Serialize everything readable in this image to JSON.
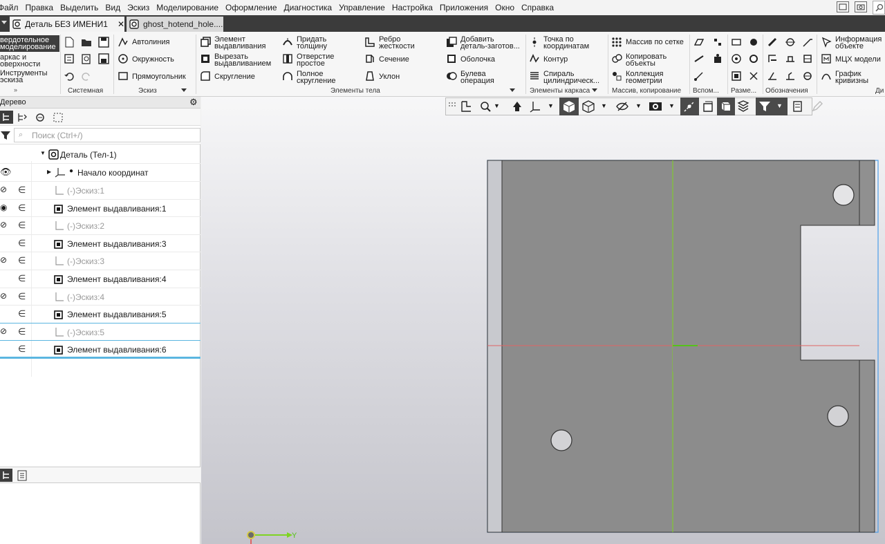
{
  "menu": [
    "Файл",
    "Правка",
    "Выделить",
    "Вид",
    "Эскиз",
    "Моделирование",
    "Оформление",
    "Диагностика",
    "Управление",
    "Настройка",
    "Приложения",
    "Окно",
    "Справка"
  ],
  "tabs": [
    {
      "label": "Деталь БЕЗ ИМЕНИ1",
      "close": "✕"
    },
    {
      "label": "ghost_hotend_hole...."
    }
  ],
  "ribbon": {
    "categories": [
      {
        "line1": "вердотельное",
        "line2": "моделирование"
      },
      {
        "line1": "аркас и",
        "line2": "оверхности"
      },
      {
        "line1": "Инструменты",
        "line2": "эскиза"
      }
    ],
    "sketch_tools": [
      "Автолиния",
      "Окружность",
      "Прямоугольник"
    ],
    "body_tools": {
      "extrude": [
        "Элемент",
        "выдавливания"
      ],
      "cut_extrude": [
        "Вырезать",
        "выдавливанием"
      ],
      "fillet": "Скругление",
      "thicken": [
        "Придать",
        "толщину"
      ],
      "hole": [
        "Отверстие",
        "простое"
      ],
      "full_fillet": [
        "Полное",
        "скругление"
      ],
      "rib": [
        "Ребро",
        "жесткости"
      ],
      "section": "Сечение",
      "draft": "Уклон",
      "add_body": [
        "Добавить",
        "деталь-заготов..."
      ],
      "shell": "Оболочка",
      "boolean": [
        "Булева",
        "операция"
      ]
    },
    "frame_tools": {
      "point": [
        "Точка по",
        "координатам"
      ],
      "contour": "Контур",
      "spiral": [
        "Спираль",
        "цилиндрическ..."
      ]
    },
    "array_tools": {
      "grid_array": "Массив по сетке",
      "copy": [
        "Копировать",
        "объекты"
      ],
      "collection": [
        "Коллекция",
        "геометрии"
      ]
    },
    "info_tools": {
      "info": [
        "Информация",
        "объекте"
      ],
      "mcx": "МЦХ модели",
      "curvature": [
        "График",
        "кривизны"
      ]
    },
    "groups": {
      "system": "Системная",
      "sketch": "Эскиз",
      "body": "Элементы тела",
      "frame": "Элементы каркаса",
      "array": "Массив, копирование",
      "aux": "Вспом...",
      "dims": "Разме...",
      "notation": "Обозначения",
      "diag": "Ди"
    }
  },
  "panel": {
    "title": "Дерево",
    "search_placeholder": "Поиск (Ctrl+/)",
    "tree": [
      {
        "label": "Деталь (Тел-1)",
        "kind": "root"
      },
      {
        "label": "Начало координат",
        "kind": "origin"
      },
      {
        "label": "(-)Эскиз:1",
        "kind": "sketch"
      },
      {
        "label": "Элемент выдавливания:1",
        "kind": "extrude"
      },
      {
        "label": "(-)Эскиз:2",
        "kind": "sketch"
      },
      {
        "label": "Элемент выдавливания:3",
        "kind": "extrude"
      },
      {
        "label": "(-)Эскиз:3",
        "kind": "sketch"
      },
      {
        "label": "Элемент выдавливания:4",
        "kind": "extrude"
      },
      {
        "label": "(-)Эскиз:4",
        "kind": "sketch"
      },
      {
        "label": "Элемент выдавливания:5",
        "kind": "extrude"
      },
      {
        "label": "(-)Эскиз:5",
        "kind": "sketch"
      },
      {
        "label": "Элемент выдавливания:6",
        "kind": "extrude"
      }
    ]
  },
  "viewport": {
    "axis_label": "Y",
    "part_color": "#8c8c8c",
    "selection_color": "#4a9de8",
    "x_axis_color": "#e06464",
    "y_axis_color": "#7ed321"
  }
}
